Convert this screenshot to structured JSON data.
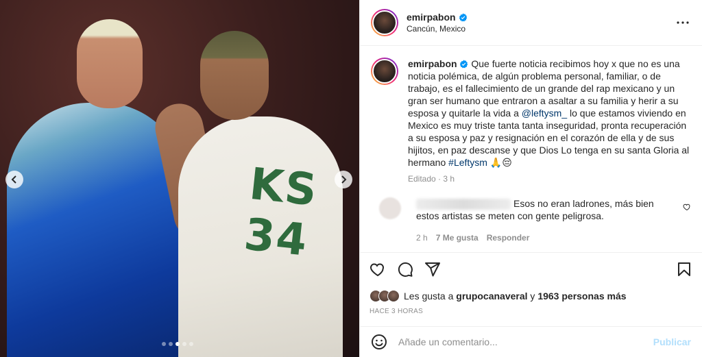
{
  "post": {
    "username": "emirpabon",
    "location": "Cancún, Mexico",
    "verified": true,
    "caption": {
      "text_before_link": "Que fuerte noticia recibimos hoy x que no es una noticia polémica, de algún problema personal, familiar, o de trabajo, es el fallecimiento de un grande del rap mexicano y un gran ser humano que entraron a asaltar a su familia y herir a su esposa y quitarle la vida a ",
      "mention": "@leftysm_",
      "text_after_link": " lo que estamos viviendo en Mexico es muy triste tanta tanta inseguridad, pronta recuperación a su esposa y paz y resignación en el corazón de ella y de sus hijitos, en paz descanse y que Dios Lo tenga en su santa Gloria al hermano ",
      "hashtag": "#Leftysm",
      "emojis": "🙏😔",
      "meta": "Editado · 3 h"
    },
    "image": {
      "jersey_text": "KS 34",
      "carousel_dots": 5,
      "active_dot": 2
    }
  },
  "comments": [
    {
      "text": "Esos no eran ladrones, más bien estos artistas se meten con gente peligrosa.",
      "time": "2 h",
      "likes": "7 Me gusta",
      "reply_label": "Responder"
    }
  ],
  "likes": {
    "prefix": "Les gusta a ",
    "user": "grupocanaveral",
    "middle": " y ",
    "count": "1963 personas más"
  },
  "time_ago": "HACE 3 HORAS",
  "comment_box": {
    "placeholder": "Añade un comentario...",
    "publish_label": "Publicar"
  },
  "icons": [
    "chevron-left-icon",
    "chevron-right-icon",
    "more-icon",
    "heart-icon",
    "comment-icon",
    "share-icon",
    "bookmark-icon",
    "emoji-icon",
    "verified-icon"
  ],
  "colors": {
    "link": "#00376b",
    "muted": "#8e8e8e",
    "publish": "#b2dffc",
    "verified": "#0095f6"
  }
}
